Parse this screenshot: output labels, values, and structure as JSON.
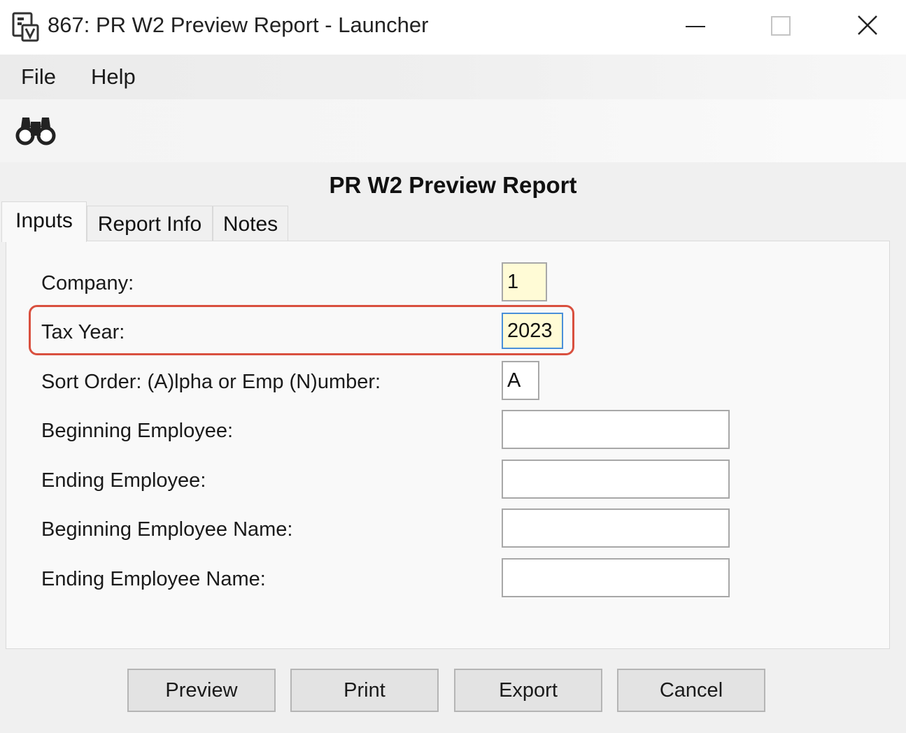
{
  "window": {
    "title": "867: PR W2 Preview Report - Launcher",
    "icon": "report-launcher-icon"
  },
  "menu": {
    "file": "File",
    "help": "Help"
  },
  "toolbar": {
    "find_icon": "binoculars-icon"
  },
  "report": {
    "title": "PR W2 Preview Report"
  },
  "tabs": [
    {
      "label": "Inputs",
      "active": true
    },
    {
      "label": "Report Info",
      "active": false
    },
    {
      "label": "Notes",
      "active": false
    }
  ],
  "fields": {
    "company": {
      "label": "Company:",
      "value": "1"
    },
    "tax_year": {
      "label": "Tax Year:",
      "value": "2023"
    },
    "sort_order": {
      "label": "Sort Order: (A)lpha or Emp (N)umber:",
      "value": "A"
    },
    "beginning_employee": {
      "label": "Beginning Employee:",
      "value": ""
    },
    "ending_employee": {
      "label": "Ending Employee:",
      "value": ""
    },
    "beginning_employee_name": {
      "label": "Beginning Employee Name:",
      "value": ""
    },
    "ending_employee_name": {
      "label": "Ending Employee Name:",
      "value": ""
    }
  },
  "buttons": {
    "preview": "Preview",
    "print": "Print",
    "export": "Export",
    "cancel": "Cancel"
  },
  "colors": {
    "highlight": "#d9503f",
    "required_field": "#fffbd6",
    "focus_border": "#4a90d9"
  }
}
